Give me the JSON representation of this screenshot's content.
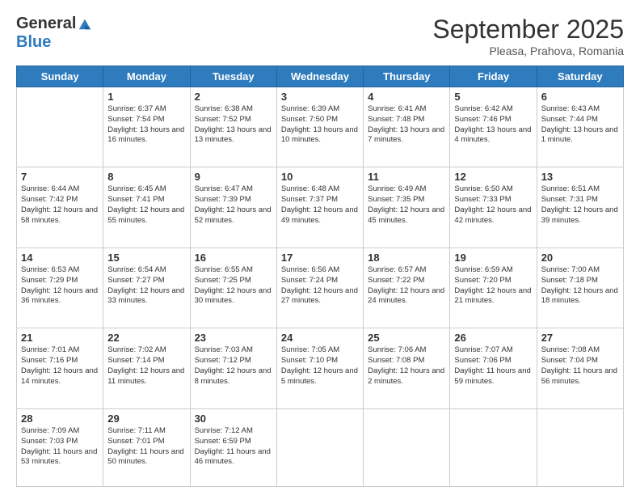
{
  "logo": {
    "general": "General",
    "blue": "Blue"
  },
  "header": {
    "month_year": "September 2025",
    "location": "Pleasa, Prahova, Romania"
  },
  "weekdays": [
    "Sunday",
    "Monday",
    "Tuesday",
    "Wednesday",
    "Thursday",
    "Friday",
    "Saturday"
  ],
  "weeks": [
    [
      {
        "day": "",
        "sunrise": "",
        "sunset": "",
        "daylight": ""
      },
      {
        "day": "1",
        "sunrise": "Sunrise: 6:37 AM",
        "sunset": "Sunset: 7:54 PM",
        "daylight": "Daylight: 13 hours and 16 minutes."
      },
      {
        "day": "2",
        "sunrise": "Sunrise: 6:38 AM",
        "sunset": "Sunset: 7:52 PM",
        "daylight": "Daylight: 13 hours and 13 minutes."
      },
      {
        "day": "3",
        "sunrise": "Sunrise: 6:39 AM",
        "sunset": "Sunset: 7:50 PM",
        "daylight": "Daylight: 13 hours and 10 minutes."
      },
      {
        "day": "4",
        "sunrise": "Sunrise: 6:41 AM",
        "sunset": "Sunset: 7:48 PM",
        "daylight": "Daylight: 13 hours and 7 minutes."
      },
      {
        "day": "5",
        "sunrise": "Sunrise: 6:42 AM",
        "sunset": "Sunset: 7:46 PM",
        "daylight": "Daylight: 13 hours and 4 minutes."
      },
      {
        "day": "6",
        "sunrise": "Sunrise: 6:43 AM",
        "sunset": "Sunset: 7:44 PM",
        "daylight": "Daylight: 13 hours and 1 minute."
      }
    ],
    [
      {
        "day": "7",
        "sunrise": "Sunrise: 6:44 AM",
        "sunset": "Sunset: 7:42 PM",
        "daylight": "Daylight: 12 hours and 58 minutes."
      },
      {
        "day": "8",
        "sunrise": "Sunrise: 6:45 AM",
        "sunset": "Sunset: 7:41 PM",
        "daylight": "Daylight: 12 hours and 55 minutes."
      },
      {
        "day": "9",
        "sunrise": "Sunrise: 6:47 AM",
        "sunset": "Sunset: 7:39 PM",
        "daylight": "Daylight: 12 hours and 52 minutes."
      },
      {
        "day": "10",
        "sunrise": "Sunrise: 6:48 AM",
        "sunset": "Sunset: 7:37 PM",
        "daylight": "Daylight: 12 hours and 49 minutes."
      },
      {
        "day": "11",
        "sunrise": "Sunrise: 6:49 AM",
        "sunset": "Sunset: 7:35 PM",
        "daylight": "Daylight: 12 hours and 45 minutes."
      },
      {
        "day": "12",
        "sunrise": "Sunrise: 6:50 AM",
        "sunset": "Sunset: 7:33 PM",
        "daylight": "Daylight: 12 hours and 42 minutes."
      },
      {
        "day": "13",
        "sunrise": "Sunrise: 6:51 AM",
        "sunset": "Sunset: 7:31 PM",
        "daylight": "Daylight: 12 hours and 39 minutes."
      }
    ],
    [
      {
        "day": "14",
        "sunrise": "Sunrise: 6:53 AM",
        "sunset": "Sunset: 7:29 PM",
        "daylight": "Daylight: 12 hours and 36 minutes."
      },
      {
        "day": "15",
        "sunrise": "Sunrise: 6:54 AM",
        "sunset": "Sunset: 7:27 PM",
        "daylight": "Daylight: 12 hours and 33 minutes."
      },
      {
        "day": "16",
        "sunrise": "Sunrise: 6:55 AM",
        "sunset": "Sunset: 7:25 PM",
        "daylight": "Daylight: 12 hours and 30 minutes."
      },
      {
        "day": "17",
        "sunrise": "Sunrise: 6:56 AM",
        "sunset": "Sunset: 7:24 PM",
        "daylight": "Daylight: 12 hours and 27 minutes."
      },
      {
        "day": "18",
        "sunrise": "Sunrise: 6:57 AM",
        "sunset": "Sunset: 7:22 PM",
        "daylight": "Daylight: 12 hours and 24 minutes."
      },
      {
        "day": "19",
        "sunrise": "Sunrise: 6:59 AM",
        "sunset": "Sunset: 7:20 PM",
        "daylight": "Daylight: 12 hours and 21 minutes."
      },
      {
        "day": "20",
        "sunrise": "Sunrise: 7:00 AM",
        "sunset": "Sunset: 7:18 PM",
        "daylight": "Daylight: 12 hours and 18 minutes."
      }
    ],
    [
      {
        "day": "21",
        "sunrise": "Sunrise: 7:01 AM",
        "sunset": "Sunset: 7:16 PM",
        "daylight": "Daylight: 12 hours and 14 minutes."
      },
      {
        "day": "22",
        "sunrise": "Sunrise: 7:02 AM",
        "sunset": "Sunset: 7:14 PM",
        "daylight": "Daylight: 12 hours and 11 minutes."
      },
      {
        "day": "23",
        "sunrise": "Sunrise: 7:03 AM",
        "sunset": "Sunset: 7:12 PM",
        "daylight": "Daylight: 12 hours and 8 minutes."
      },
      {
        "day": "24",
        "sunrise": "Sunrise: 7:05 AM",
        "sunset": "Sunset: 7:10 PM",
        "daylight": "Daylight: 12 hours and 5 minutes."
      },
      {
        "day": "25",
        "sunrise": "Sunrise: 7:06 AM",
        "sunset": "Sunset: 7:08 PM",
        "daylight": "Daylight: 12 hours and 2 minutes."
      },
      {
        "day": "26",
        "sunrise": "Sunrise: 7:07 AM",
        "sunset": "Sunset: 7:06 PM",
        "daylight": "Daylight: 11 hours and 59 minutes."
      },
      {
        "day": "27",
        "sunrise": "Sunrise: 7:08 AM",
        "sunset": "Sunset: 7:04 PM",
        "daylight": "Daylight: 11 hours and 56 minutes."
      }
    ],
    [
      {
        "day": "28",
        "sunrise": "Sunrise: 7:09 AM",
        "sunset": "Sunset: 7:03 PM",
        "daylight": "Daylight: 11 hours and 53 minutes."
      },
      {
        "day": "29",
        "sunrise": "Sunrise: 7:11 AM",
        "sunset": "Sunset: 7:01 PM",
        "daylight": "Daylight: 11 hours and 50 minutes."
      },
      {
        "day": "30",
        "sunrise": "Sunrise: 7:12 AM",
        "sunset": "Sunset: 6:59 PM",
        "daylight": "Daylight: 11 hours and 46 minutes."
      },
      {
        "day": "",
        "sunrise": "",
        "sunset": "",
        "daylight": ""
      },
      {
        "day": "",
        "sunrise": "",
        "sunset": "",
        "daylight": ""
      },
      {
        "day": "",
        "sunrise": "",
        "sunset": "",
        "daylight": ""
      },
      {
        "day": "",
        "sunrise": "",
        "sunset": "",
        "daylight": ""
      }
    ]
  ]
}
